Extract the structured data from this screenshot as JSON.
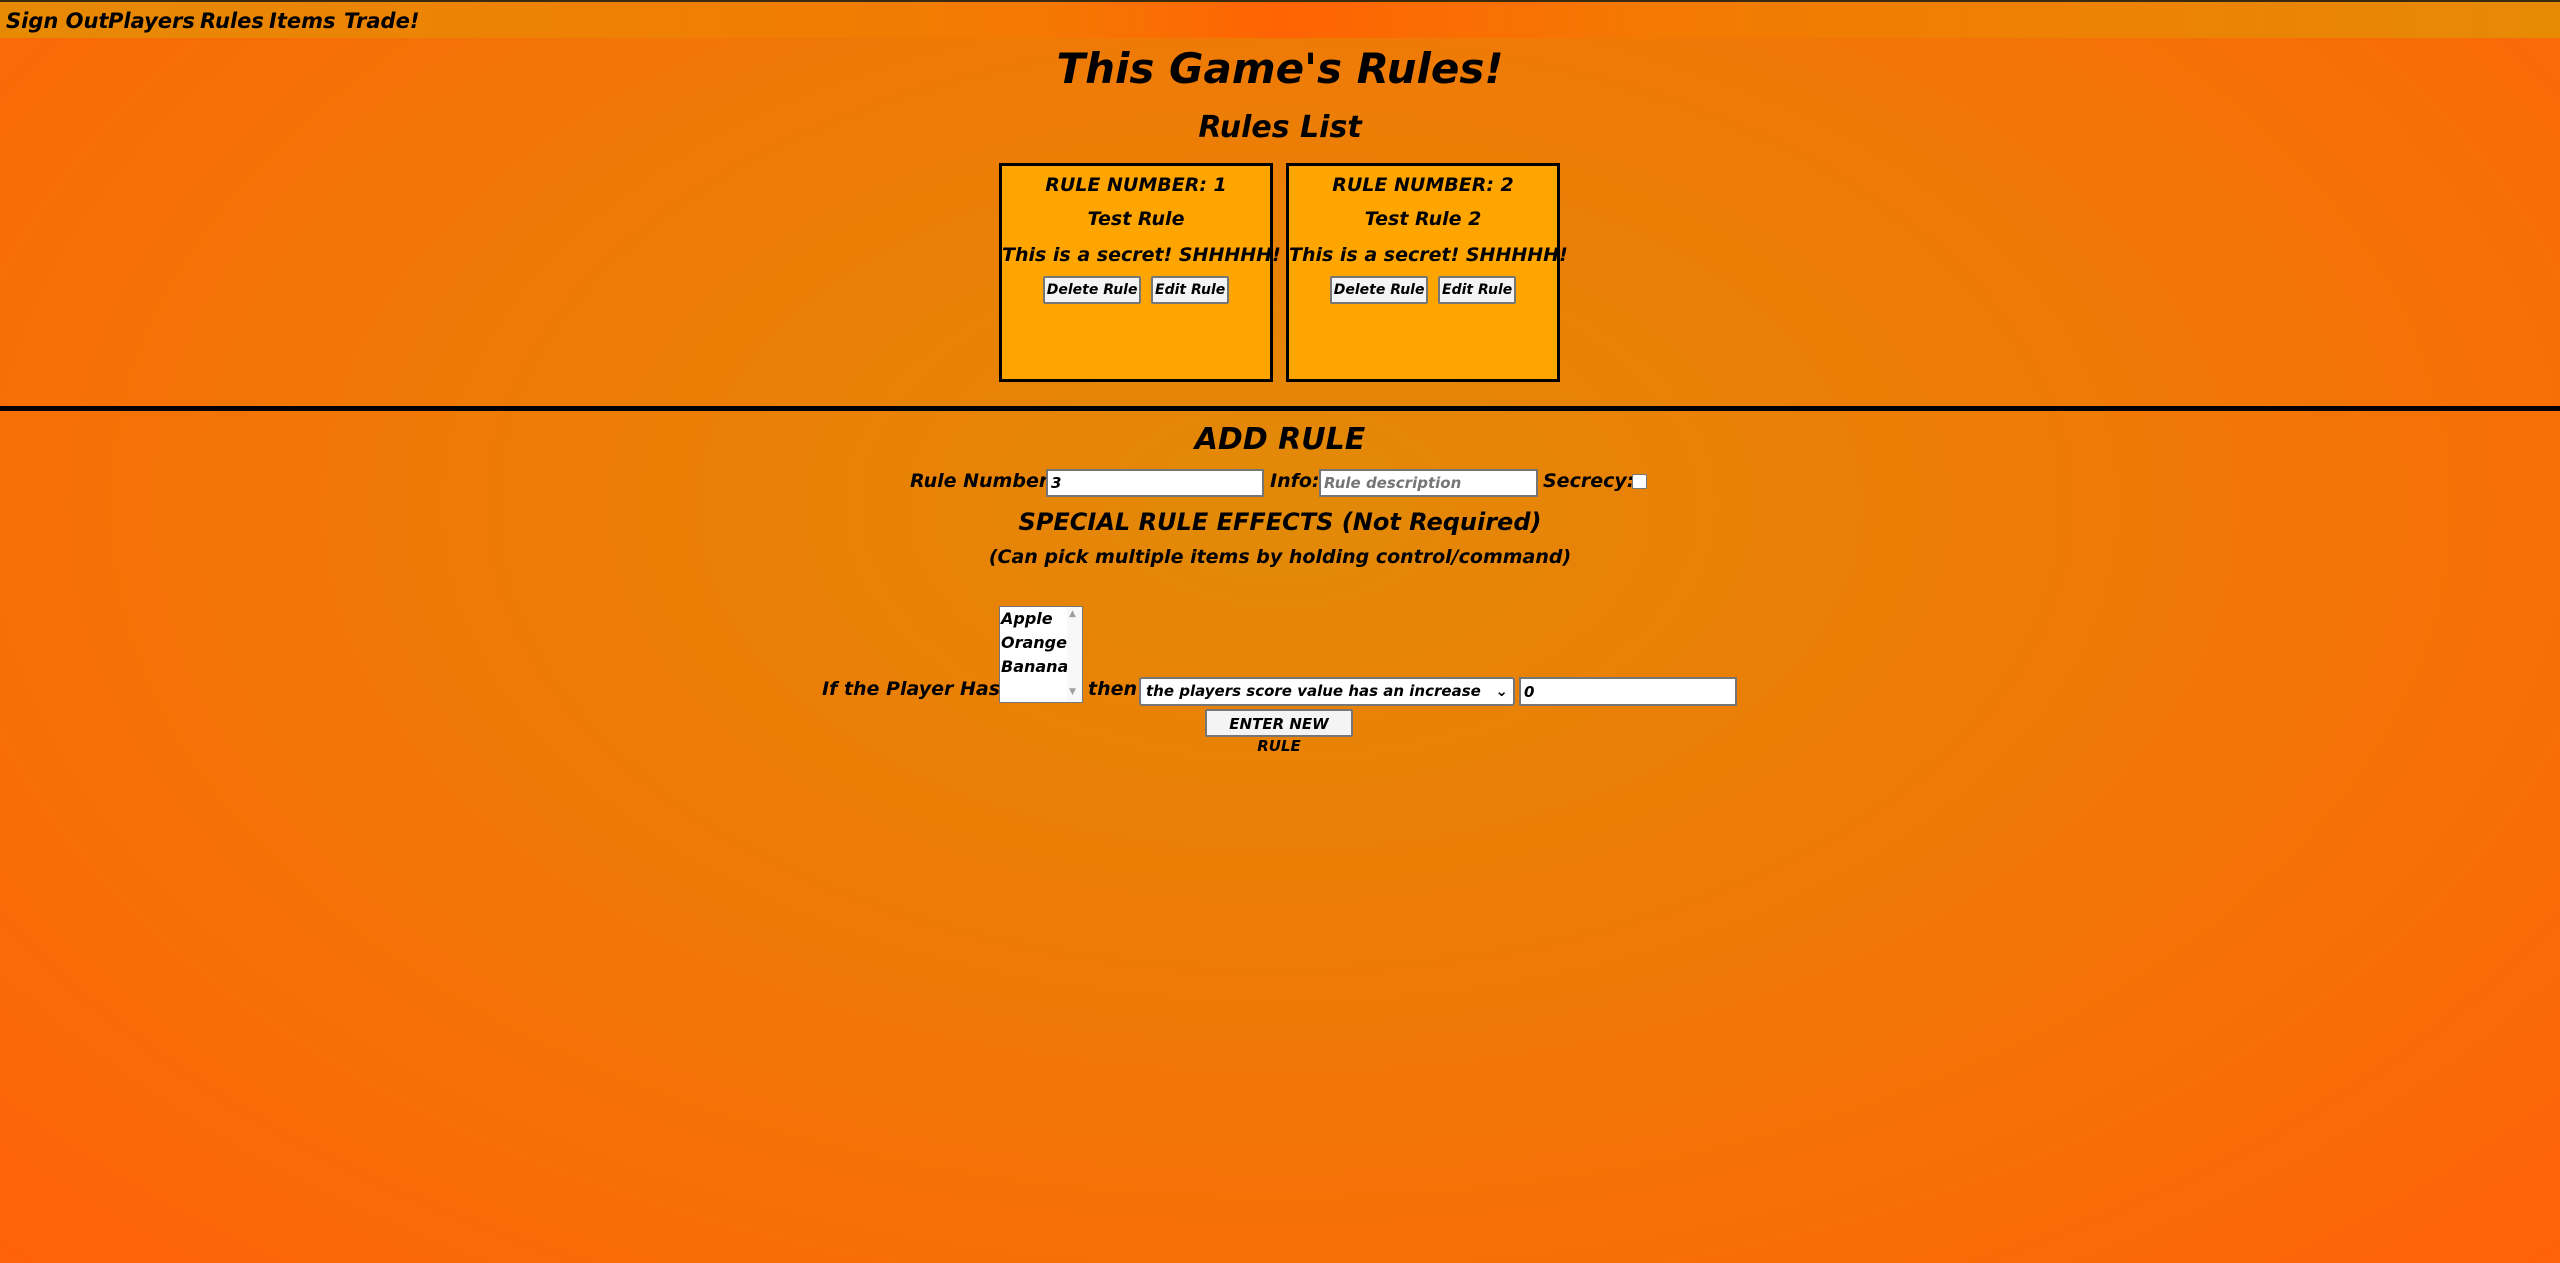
{
  "nav": {
    "items": [
      "Sign Out",
      "Players",
      "Rules",
      "Items",
      "Trade!"
    ]
  },
  "page": {
    "title": "This Game's Rules!",
    "rules_list_heading": "Rules List"
  },
  "rules": [
    {
      "number_label": "RULE NUMBER: 1",
      "name": "Test Rule",
      "info": "This is a secret! SHHHHH!",
      "delete_label": "Delete Rule",
      "edit_label": "Edit Rule"
    },
    {
      "number_label": "RULE NUMBER: 2",
      "name": "Test Rule 2",
      "info": "This is a secret! SHHHHH!",
      "delete_label": "Delete Rule",
      "edit_label": "Edit Rule"
    }
  ],
  "add_rule": {
    "heading": "ADD RULE",
    "rule_number_label": "Rule Number:",
    "rule_number_value": "3",
    "info_label": "Info:",
    "info_placeholder": "Rule description",
    "secrecy_label": "Secrecy:",
    "special_heading": "SPECIAL RULE EFFECTS (Not Required)",
    "special_sub": "(Can pick multiple items by holding control/command)",
    "if_label": "If the Player Has:",
    "items_options": [
      "Apple",
      "Orange",
      "Banana"
    ],
    "then_label": "then",
    "effect_selected": "the players score value has an increase of",
    "amount_value": "0",
    "submit_label": "ENTER NEW RULE"
  },
  "colors": {
    "card_background": "#ffa500",
    "page_gradient_center": "#e28a08",
    "page_gradient_edge": "#ff6208"
  },
  "icons": {
    "select_chevron": "chevron-down-icon",
    "listbox_scroll_up": "caret-up-icon",
    "listbox_scroll_down": "caret-down-icon"
  }
}
